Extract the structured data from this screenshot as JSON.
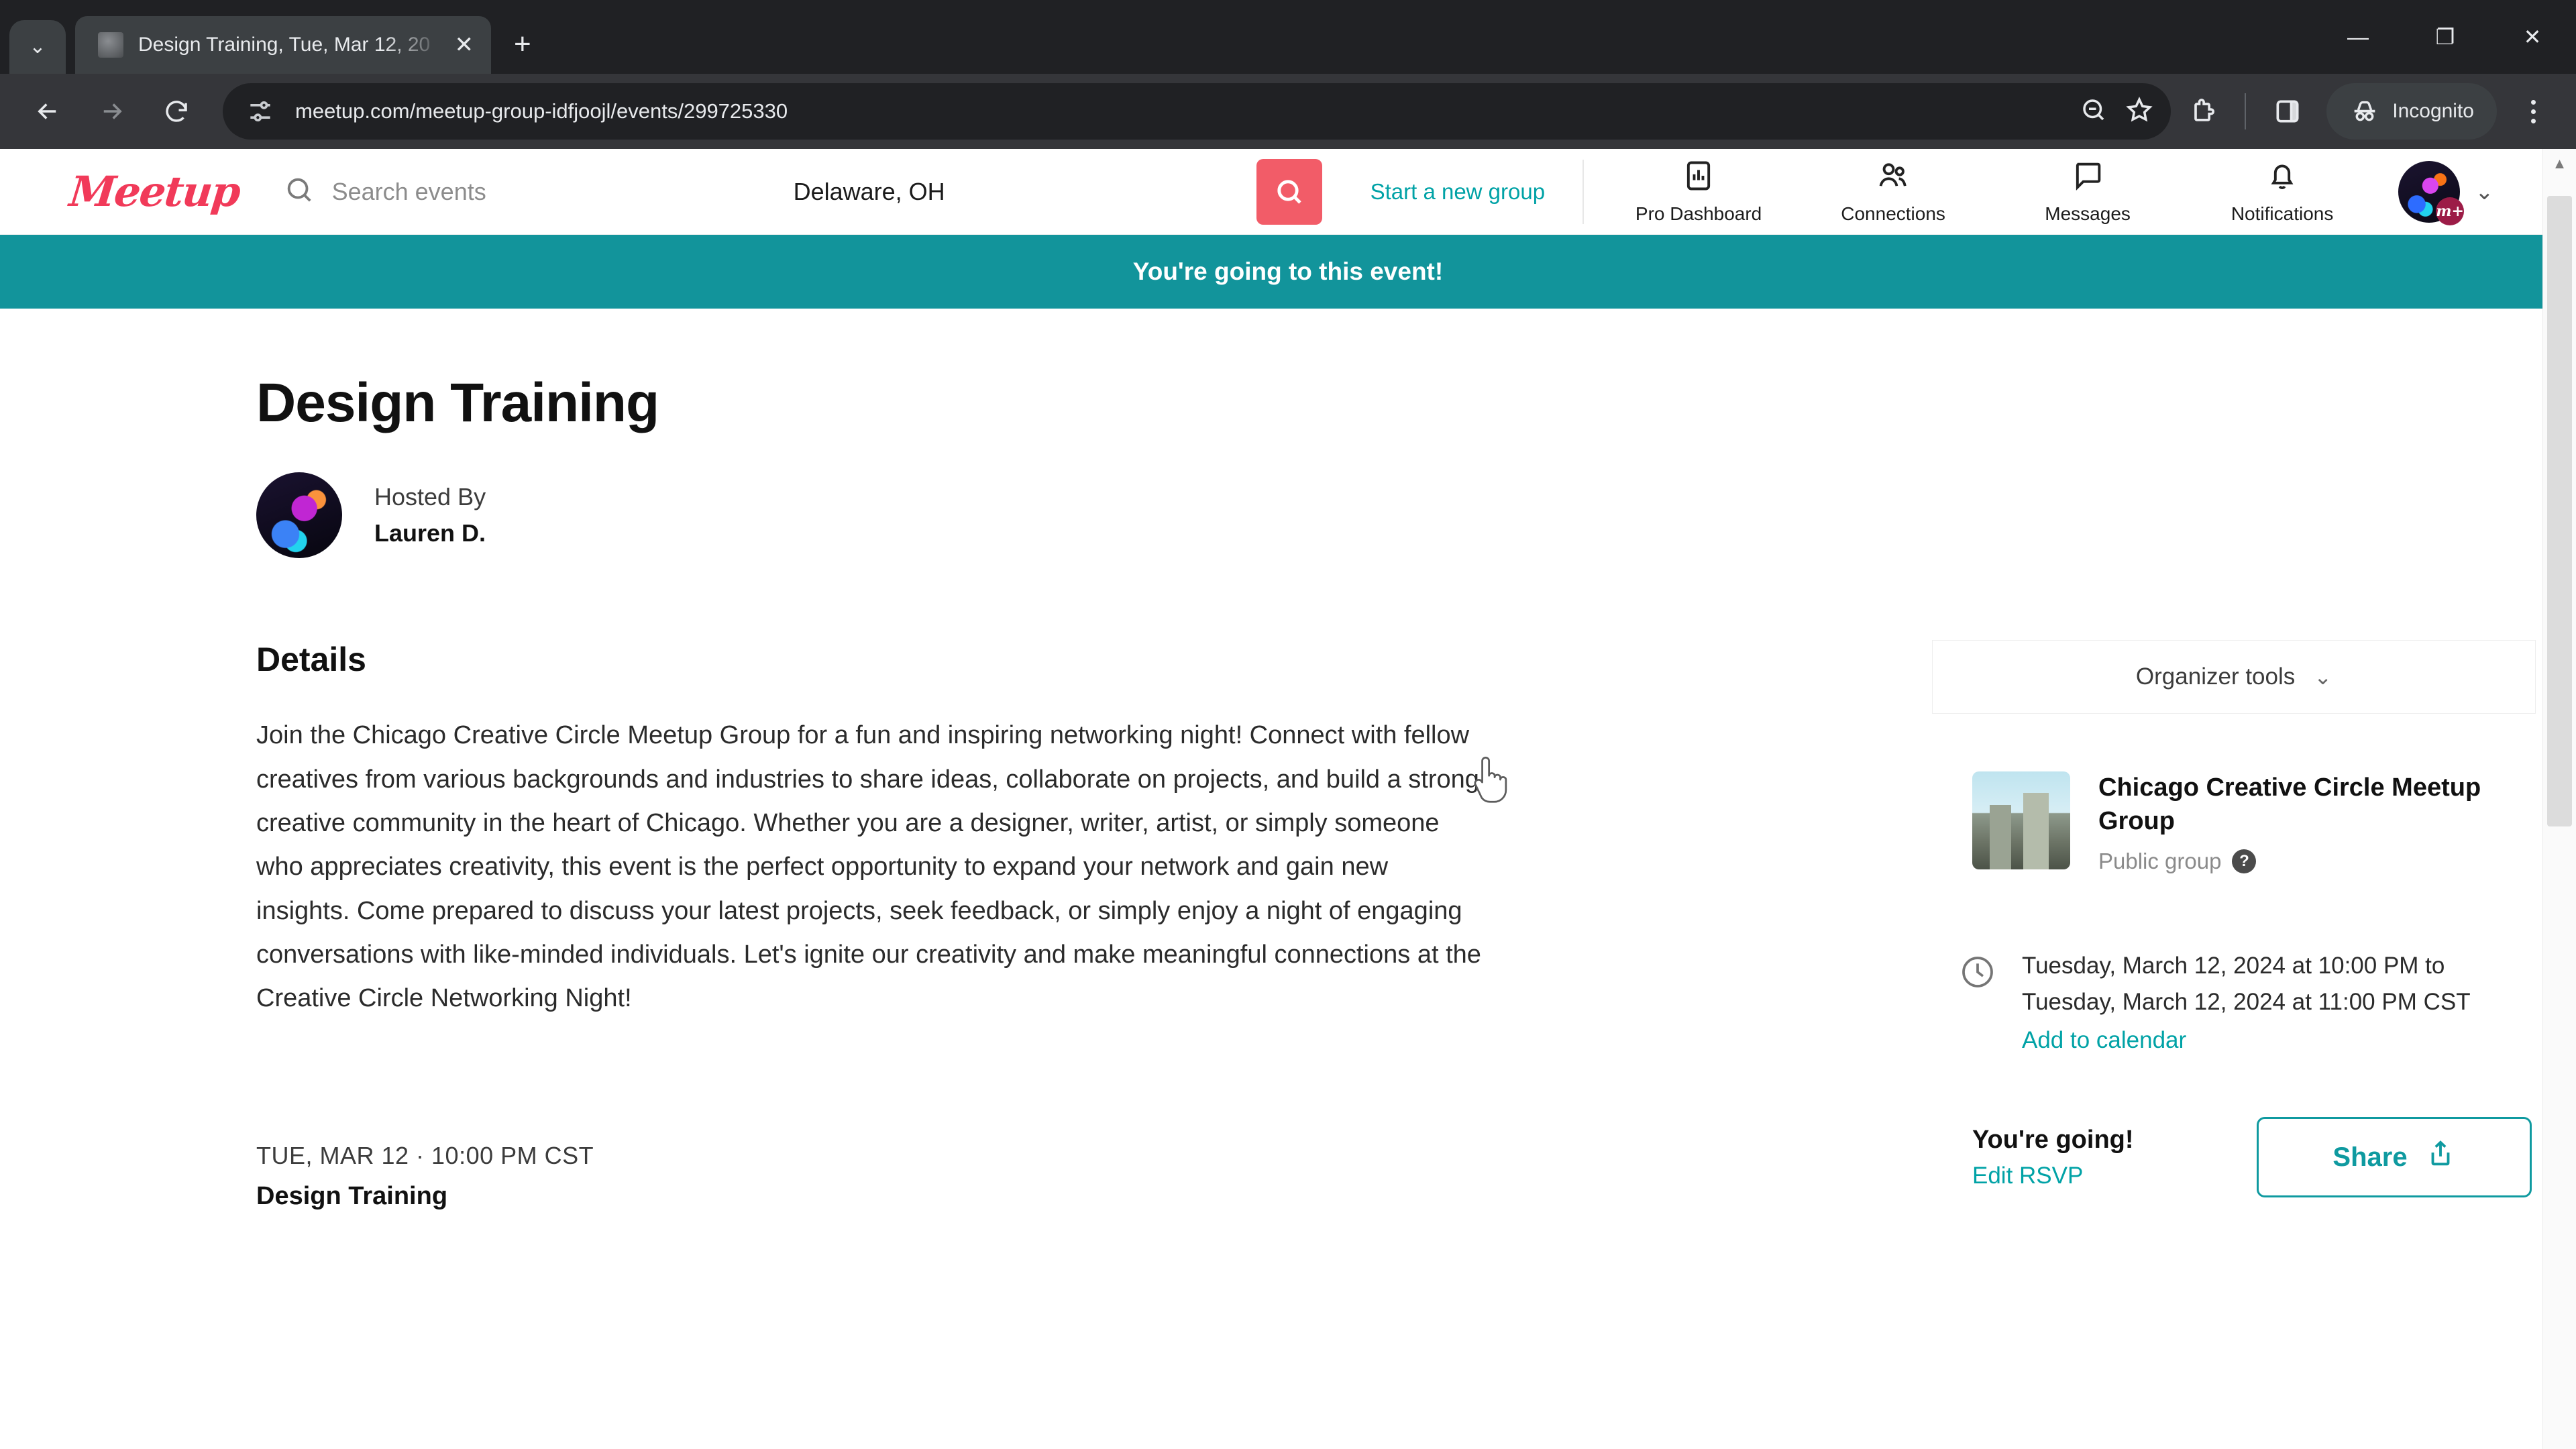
{
  "browser": {
    "tab": {
      "title": "Design Training, Tue, Mar 12, 20",
      "close_label": "✕"
    },
    "new_tab_label": "+",
    "window_controls": {
      "minimize": "—",
      "maximize": "❐",
      "close": "✕"
    },
    "toolbar": {
      "back_label": "Back",
      "forward_label": "Forward",
      "reload_label": "Reload",
      "url": "meetup.com/meetup-group-idfjoojl/events/299725330",
      "site_info_icon": "tune-icon",
      "zoom_icon": "search-icon",
      "bookmark_icon": "star-icon",
      "extensions_icon": "puzzle-icon",
      "side_panel_icon": "side-panel-icon",
      "incognito_label": "Incognito",
      "menu_icon": "kebab-menu-icon"
    }
  },
  "header": {
    "logo_text": "Meetup",
    "search_placeholder": "Search events",
    "location_value": "Delaware, OH",
    "search_button_icon": "search-icon",
    "start_group_label": "Start a new group",
    "nav": [
      {
        "label": "Pro Dashboard",
        "icon": "chart-icon"
      },
      {
        "label": "Connections",
        "icon": "people-icon"
      },
      {
        "label": "Messages",
        "icon": "chat-bubble-icon"
      },
      {
        "label": "Notifications",
        "icon": "bell-icon"
      }
    ],
    "avatar_badge": "m+",
    "avatar_caret": "⌄"
  },
  "banner": {
    "text": "You're going to this event!",
    "color": "#12949b"
  },
  "event": {
    "title": "Design Training",
    "hosted_by_label": "Hosted By",
    "host_name": "Lauren D."
  },
  "details": {
    "heading": "Details",
    "body": "Join the Chicago Creative Circle Meetup Group for a fun and inspiring networking night! Connect with fellow creatives from various backgrounds and industries to share ideas, collaborate on projects, and build a strong creative community in the heart of Chicago. Whether you are a designer, writer, artist, or simply someone who appreciates creativity, this event is the perfect opportunity to expand your network and gain new insights. Come prepared to discuss your latest projects, seek feedback, or simply enjoy a night of engaging conversations with like-minded individuals. Let's ignite our creativity and make meaningful connections at the Creative Circle Networking Night!"
  },
  "schedule_item": {
    "date_line": "TUE, MAR 12 · 10:00 PM CST",
    "title": "Design Training"
  },
  "sidebar": {
    "organizer_tools_label": "Organizer tools",
    "organizer_tools_chevron": "⌄",
    "group": {
      "name": "Chicago Creative Circle Meetup Group",
      "visibility": "Public group",
      "help_icon": "question-mark-icon"
    },
    "when": {
      "icon": "clock-icon",
      "lines": "Tuesday, March 12, 2024 at 10:00 PM to Tuesday, March 12, 2024 at 11:00 PM CST",
      "add_to_calendar": "Add to calendar"
    },
    "rsvp": {
      "status": "You're going!",
      "edit_label": "Edit RSVP",
      "share_label": "Share",
      "share_icon": "share-upload-icon"
    }
  },
  "colors": {
    "meetup_red": "#f13a59",
    "teal": "#00a2a6",
    "banner_teal": "#12949b",
    "search_button": "#f25c68"
  }
}
